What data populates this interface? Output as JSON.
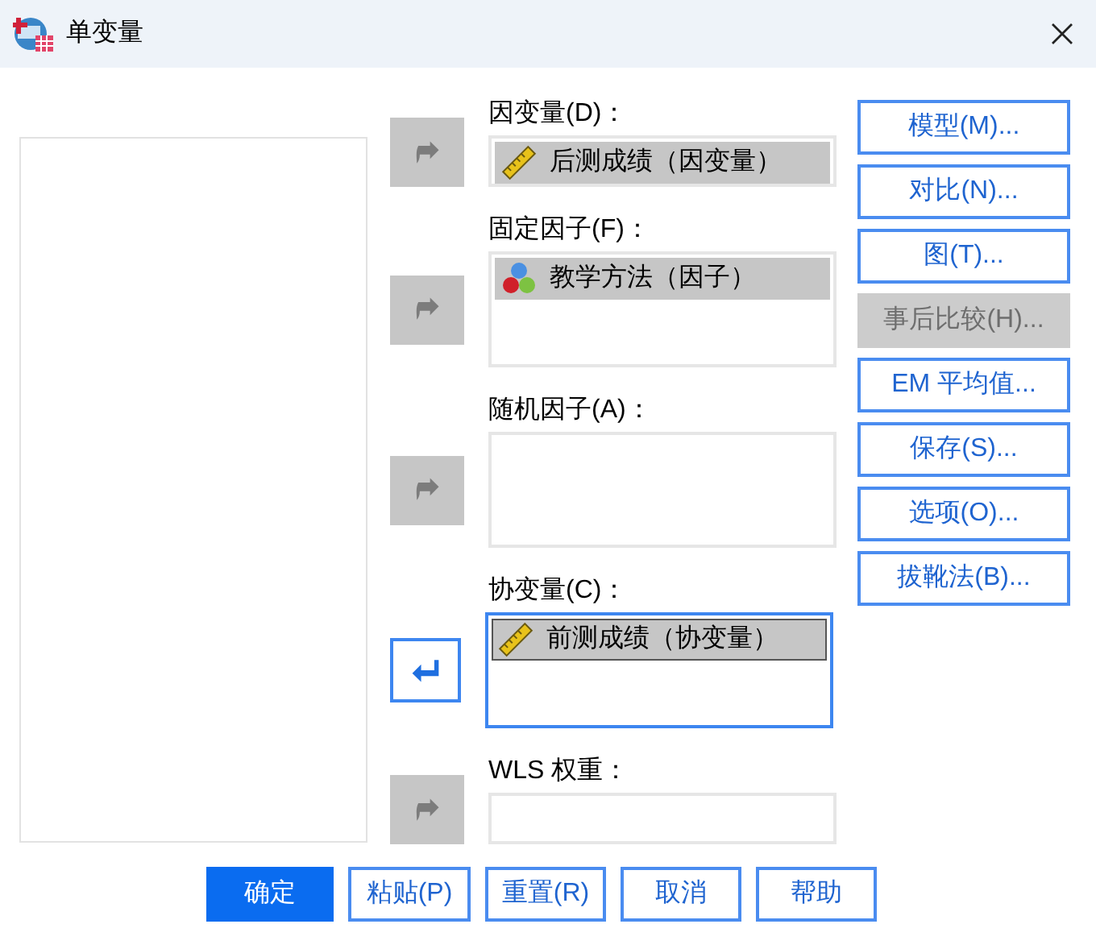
{
  "window": {
    "title": "单变量"
  },
  "targets": [
    {
      "label": "因变量(D)：",
      "kind": "single",
      "arrow": {
        "remove": false,
        "disabled": true
      },
      "focused": false,
      "items": [
        {
          "text": "后测成绩（因变量）",
          "kind": "scale",
          "selected": false
        }
      ]
    },
    {
      "label": "固定因子(F)：",
      "kind": "list",
      "arrow": {
        "remove": false,
        "disabled": true
      },
      "focused": false,
      "items": [
        {
          "text": "教学方法（因子）",
          "kind": "nominal",
          "selected": false
        }
      ]
    },
    {
      "label": "随机因子(A)：",
      "kind": "list",
      "arrow": {
        "remove": false,
        "disabled": true
      },
      "focused": false
    },
    {
      "label": "协变量(C)：",
      "kind": "list",
      "arrow": {
        "remove": true,
        "disabled": false
      },
      "focused": true,
      "items": [
        {
          "text": "前测成绩（协变量）",
          "kind": "scale",
          "selected": true
        }
      ]
    },
    {
      "label": "WLS 权重：",
      "kind": "single",
      "arrow": {
        "remove": false,
        "disabled": true
      },
      "focused": false
    }
  ],
  "side_buttons": [
    {
      "label": "模型(M)...",
      "disabled": false
    },
    {
      "label": "对比(N)...",
      "disabled": false
    },
    {
      "label": "图(T)...",
      "disabled": false
    },
    {
      "label": "事后比较(H)...",
      "disabled": true
    },
    {
      "label": "EM 平均值...",
      "disabled": false
    },
    {
      "label": "保存(S)...",
      "disabled": false
    },
    {
      "label": "选项(O)...",
      "disabled": false
    },
    {
      "label": "拔靴法(B)...",
      "disabled": false
    }
  ],
  "buttons": [
    {
      "label": "确定",
      "default": true
    },
    {
      "label": "粘贴(P)",
      "default": false
    },
    {
      "label": "重置(R)",
      "default": false
    },
    {
      "label": "取消",
      "default": false
    },
    {
      "label": "帮助",
      "default": false
    }
  ]
}
